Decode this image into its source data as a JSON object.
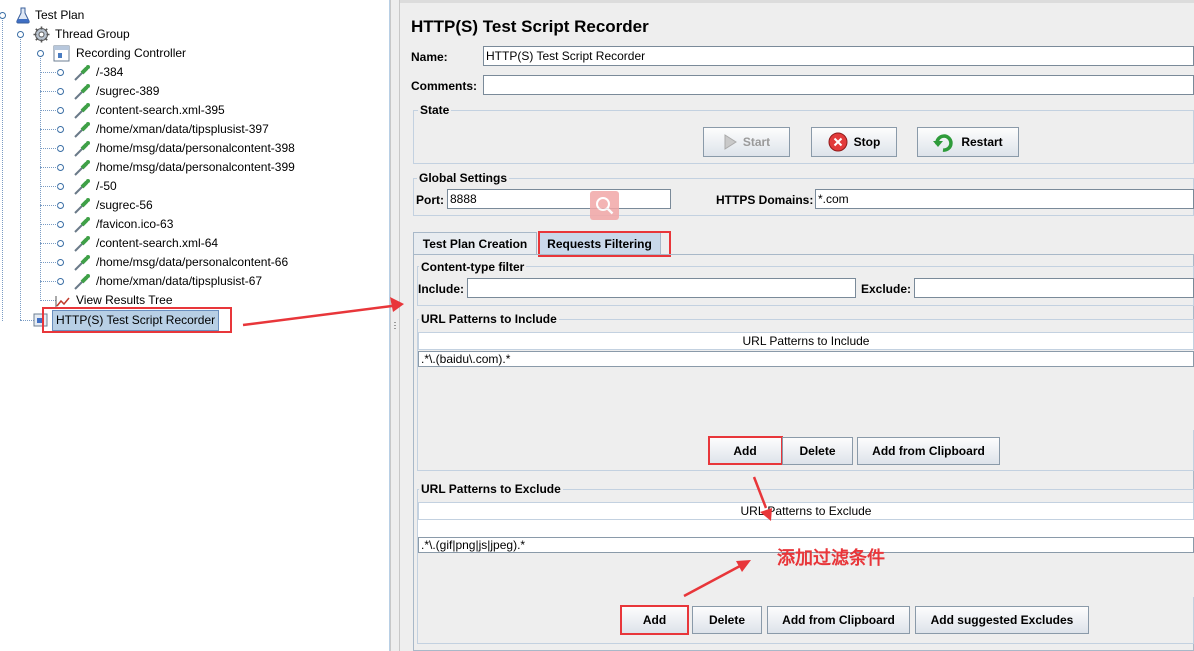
{
  "colors": {
    "annotation_red": "#e8363a",
    "selection": "#b8cfe5"
  },
  "tree": {
    "test_plan": "Test Plan",
    "thread_group": "Thread Group",
    "recording_controller": "Recording Controller",
    "samplers": [
      "/-384",
      "/sugrec-389",
      "/content-search.xml-395",
      "/home/xman/data/tipsplusist-397",
      "/home/msg/data/personalcontent-398",
      "/home/msg/data/personalcontent-399",
      "/-50",
      "/sugrec-56",
      "/favicon.ico-63",
      "/content-search.xml-64",
      "/home/msg/data/personalcontent-66",
      "/home/xman/data/tipsplusist-67"
    ],
    "view_results_tree": "View Results Tree",
    "recorder": "HTTP(S) Test Script Recorder"
  },
  "main": {
    "title": "HTTP(S) Test Script Recorder",
    "name_label": "Name:",
    "name_value": "HTTP(S) Test Script Recorder",
    "comments_label": "Comments:",
    "comments_value": "",
    "state": {
      "title": "State",
      "start": "Start",
      "stop": "Stop",
      "restart": "Restart"
    },
    "global": {
      "title": "Global Settings",
      "port_label": "Port:",
      "port_value": "8888",
      "https_label": "HTTPS Domains:",
      "https_value": "*.com"
    },
    "tabs": [
      "Test Plan Creation",
      "Requests Filtering"
    ],
    "content_type": {
      "title": "Content-type filter",
      "include_label": "Include:",
      "include_value": "",
      "exclude_label": "Exclude:",
      "exclude_value": ""
    },
    "include_patterns": {
      "title": "URL Patterns to Include",
      "header": "URL Patterns to Include",
      "rows": [
        ".*\\.(baidu\\.com).*"
      ],
      "add": "Add",
      "delete": "Delete",
      "add_clipboard": "Add from Clipboard"
    },
    "exclude_patterns": {
      "title": "URL Patterns to Exclude",
      "header": "URL Patterns to Exclude",
      "rows": [
        ".*\\.(gif|png|js|jpeg).*"
      ],
      "add": "Add",
      "delete": "Delete",
      "add_clipboard": "Add from Clipboard",
      "add_suggested": "Add suggested Excludes"
    },
    "annotation": "添加过滤条件"
  }
}
